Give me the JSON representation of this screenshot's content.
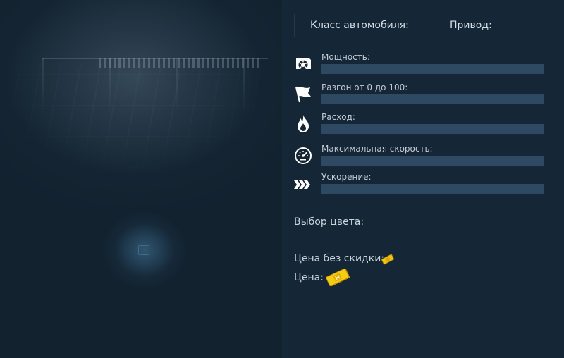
{
  "header": {
    "car_class_label": "Класс автомобиля:",
    "drive_label": "Привод:"
  },
  "stats": [
    {
      "label": "Мощность:",
      "icon": "turbo-icon",
      "value": 0
    },
    {
      "label": "Разгон от 0 до 100:",
      "icon": "flag-icon",
      "value": 0
    },
    {
      "label": "Расход:",
      "icon": "fire-icon",
      "value": 0
    },
    {
      "label": "Максимальная скорость:",
      "icon": "speedometer-icon",
      "value": 0
    },
    {
      "label": "Ускорение:",
      "icon": "acceleration-arrows-icon",
      "value": 0
    }
  ],
  "color_picker": {
    "label": "Выбор цвета:"
  },
  "price": {
    "full_price_label": "Цена без скидки:",
    "full_price_icon": "gold-ticket-icon",
    "price_label": "Цена:",
    "price_icon": "gold-ticket-icon"
  },
  "colors": {
    "background": "#152636",
    "bar_track": "#2e4a63",
    "text": "#c9d4de",
    "gold": "#f2c40f"
  }
}
